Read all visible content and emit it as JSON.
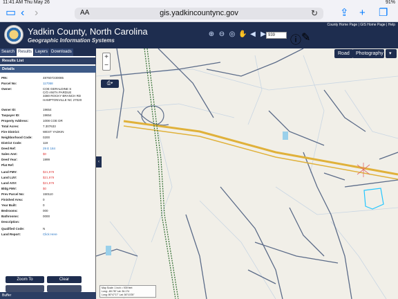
{
  "status": {
    "time": "11:41 AM",
    "date": "Thu May 26",
    "battery": "91%"
  },
  "browser": {
    "aa": "AA",
    "domain": "gis.yadkincountync.gov"
  },
  "app": {
    "title": "Yadkin County, North Carolina",
    "subtitle": "Geographic Information Systems",
    "links": "County Home Page | GIS Home Page | Help",
    "scale": "939"
  },
  "tabs": [
    "Search",
    "Results",
    "Layers",
    "Downloads"
  ],
  "sections": {
    "results": "Results List",
    "details": "Details"
  },
  "details": [
    {
      "k": "PIN:",
      "v": "487607230085"
    },
    {
      "k": "Parcel No:",
      "v": "117058"
    },
    {
      "k": "Owner:",
      "v": "COE GERALDINE S\nC/O ANITA PARDUE\n3380 ROCKY BRANCH RD\nHAMPTONVILLE NC 27020"
    },
    {
      "k": "Owner ID:",
      "v": "19654"
    },
    {
      "k": "Taxpayer ID:",
      "v": "19654"
    },
    {
      "k": "Property Address:",
      "v": "1008 COE DR"
    },
    {
      "k": "Total Acres:",
      "v": "7.307633"
    },
    {
      "k": "Fire District:",
      "v": "WEST YADKIN"
    },
    {
      "k": "Neighborhood Code:",
      "v": "0200"
    },
    {
      "k": "District Code:",
      "v": "119"
    },
    {
      "k": "Deed Ref:",
      "v": "29 E 184"
    },
    {
      "k": "Sales Amt:",
      "v": "$0"
    },
    {
      "k": "Deed Year:",
      "v": "1999"
    },
    {
      "k": "Plat Ref:",
      "v": ""
    },
    {
      "k": "Land FMV:",
      "v": "$21,979"
    },
    {
      "k": "Land LUV:",
      "v": "$21,979"
    },
    {
      "k": "Land ASV:",
      "v": "$21,979"
    },
    {
      "k": "Bldg FMV:",
      "v": "$0"
    },
    {
      "k": "Prev Parcel No:",
      "v": "150110"
    },
    {
      "k": "Finished Area:",
      "v": "0"
    },
    {
      "k": "Year Built:",
      "v": "0"
    },
    {
      "k": "Bedrooms:",
      "v": "000"
    },
    {
      "k": "Bathrooms:",
      "v": "0000"
    },
    {
      "k": "Description:",
      "v": ""
    },
    {
      "k": "Qualified Code:",
      "v": "N"
    },
    {
      "k": "Land Report:",
      "v": "Click Here"
    }
  ],
  "buttons": {
    "zoom_to": "Zoom To",
    "clear": "Clear"
  },
  "buffer": "Buffer",
  "map": {
    "road_label": "Road",
    "photo_label": "Photography",
    "zoom_in": "+",
    "zoom_out": "−",
    "scale_text": "Map Scale: 1 inch = 939 feet",
    "coords_text": "Long: -80.787 Lat: 36.174\nLong: 80°47'17\" Lat: 36°10'25\""
  },
  "colors": {
    "navy": "#1e2d4f",
    "highway": "#e0b13a",
    "parcel": "#c9d6e3"
  }
}
